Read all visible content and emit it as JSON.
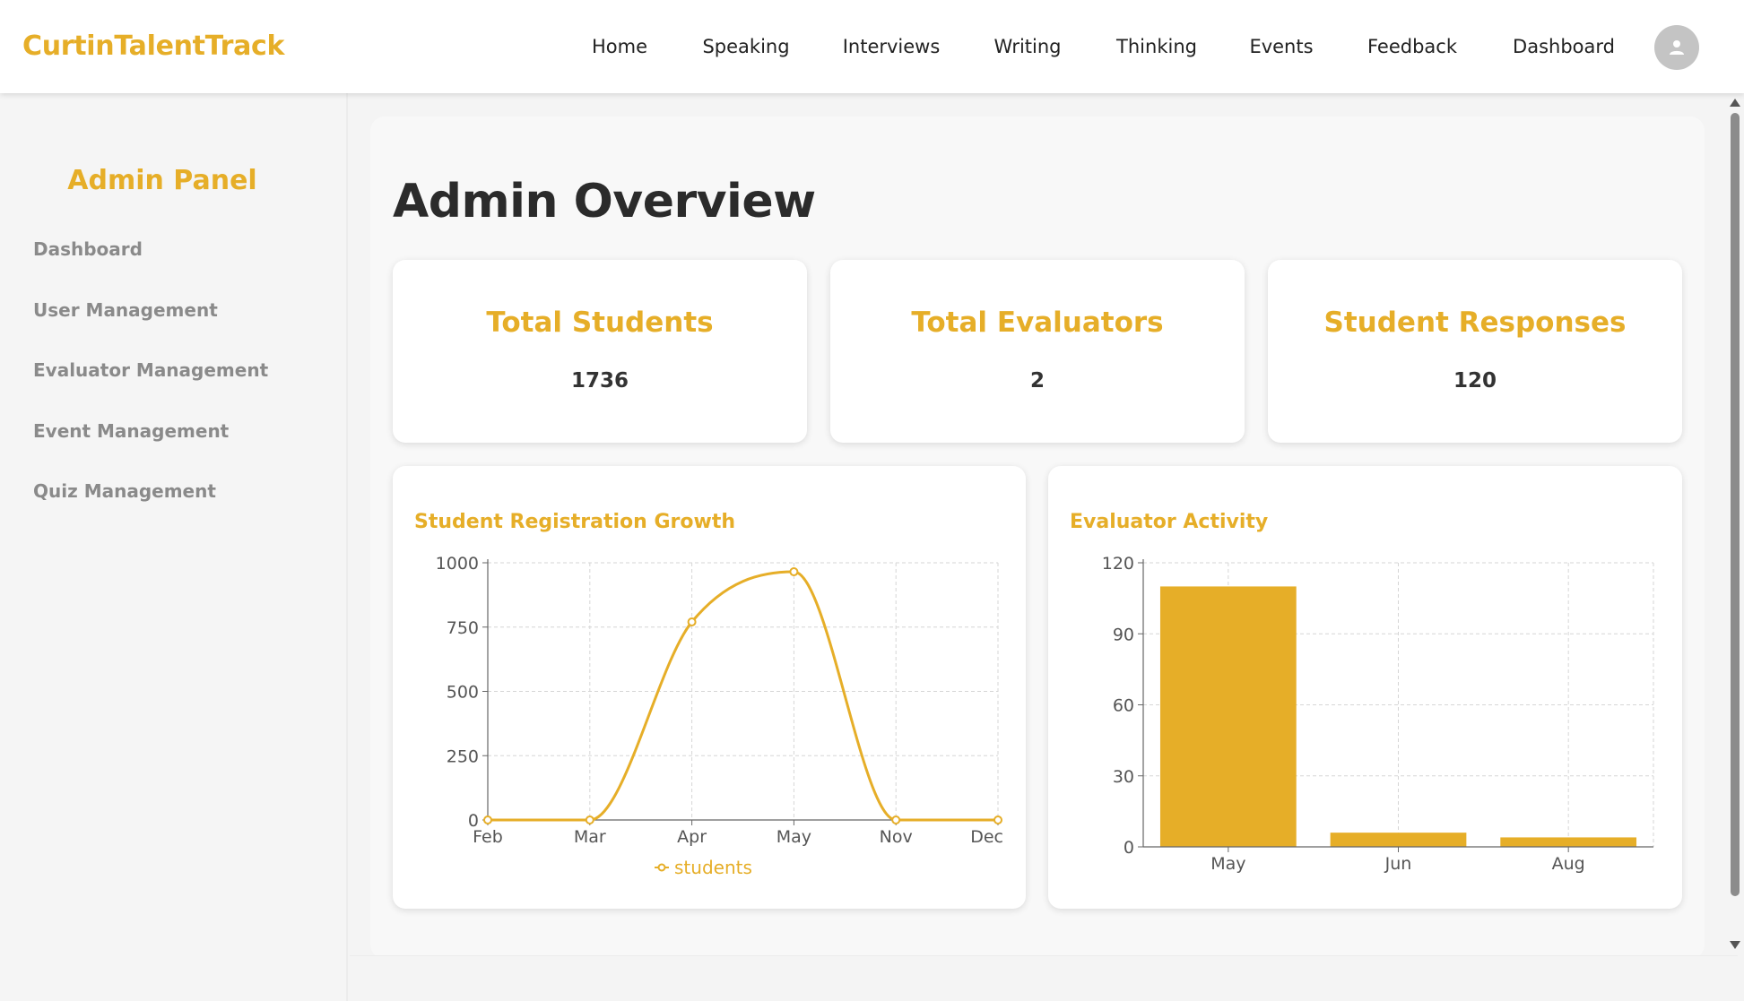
{
  "brand": "CurtinTalentTrack",
  "nav": {
    "items": [
      "Home",
      "Speaking",
      "Interviews",
      "Writing",
      "Thinking",
      "Events",
      "Feedback",
      "Dashboard"
    ]
  },
  "sidebar": {
    "title": "Admin Panel",
    "items": [
      "Dashboard",
      "User Management",
      "Evaluator Management",
      "Event Management",
      "Quiz Management"
    ]
  },
  "main": {
    "title": "Admin Overview",
    "stats": [
      {
        "label": "Total Students",
        "value": "1736"
      },
      {
        "label": "Total Evaluators",
        "value": "2"
      },
      {
        "label": "Student Responses",
        "value": "120"
      }
    ]
  },
  "colors": {
    "accent": "#e6ae28",
    "grid": "#d6d6d6",
    "axis": "#666666"
  },
  "chart_data": [
    {
      "type": "line",
      "title": "Student Registration Growth",
      "categories": [
        "Feb",
        "Mar",
        "Apr",
        "May",
        "Nov",
        "Dec"
      ],
      "series": [
        {
          "name": "students",
          "values": [
            0,
            0,
            770,
            965,
            0,
            0
          ]
        }
      ],
      "ylim": [
        0,
        1000
      ],
      "yticks": [
        0,
        250,
        500,
        750,
        1000
      ],
      "grid": true,
      "legend": "bottom"
    },
    {
      "type": "bar",
      "title": "Evaluator Activity",
      "categories": [
        "May",
        "Jun",
        "Aug"
      ],
      "values": [
        110,
        6,
        4
      ],
      "ylim": [
        0,
        120
      ],
      "yticks": [
        0,
        30,
        60,
        90,
        120
      ],
      "grid": true
    }
  ]
}
